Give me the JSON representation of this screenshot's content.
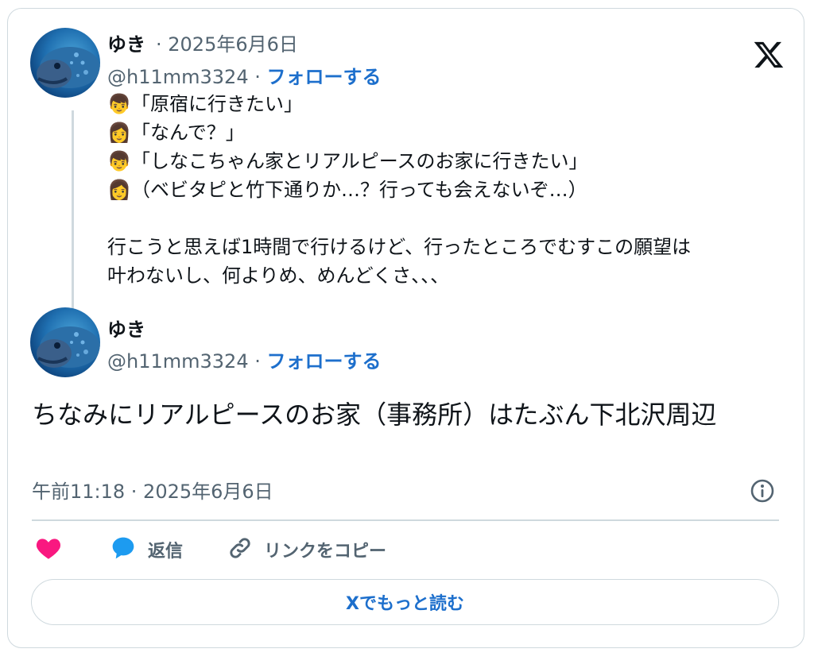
{
  "first_post": {
    "display_name": "ゆき",
    "date": "· 2025年6月6日",
    "handle": "@h11mm3324 ·",
    "follow_label": "フォローする",
    "lines": [
      {
        "emoji": "👦",
        "text": "「原宿に行きたい」"
      },
      {
        "emoji": "👩",
        "text": "「なんで？」"
      },
      {
        "emoji": "👦",
        "text": "「しなこちゃん家とリアルピースのお家に行きたい」"
      },
      {
        "emoji": "👩",
        "text": "（ベビタピと竹下通りか…？行っても会えないぞ…）"
      }
    ],
    "paragraph_1": "行こうと思えば1時間で行けるけど、行ったところでむすこの願望は",
    "paragraph_2": "叶わないし、何よりめ、めんどくさ、、、"
  },
  "second_post": {
    "display_name": "ゆき",
    "handle": "@h11mm3324 ·",
    "follow_label": "フォローする",
    "text": "ちなみにリアルピースのお家（事務所）はたぶん下北沢周辺",
    "timestamp": "午前11:18 · 2025年6月6日"
  },
  "actions": {
    "like_icon": "heart-icon",
    "reply_label": "返信",
    "copy_link_label": "リンクをコピー"
  },
  "read_more_label": "Xでもっと読む",
  "colors": {
    "accent": "#1d6fcc",
    "like": "#f91880",
    "reply": "#1d9bf0",
    "muted": "#536471",
    "border": "#cfd9de"
  }
}
